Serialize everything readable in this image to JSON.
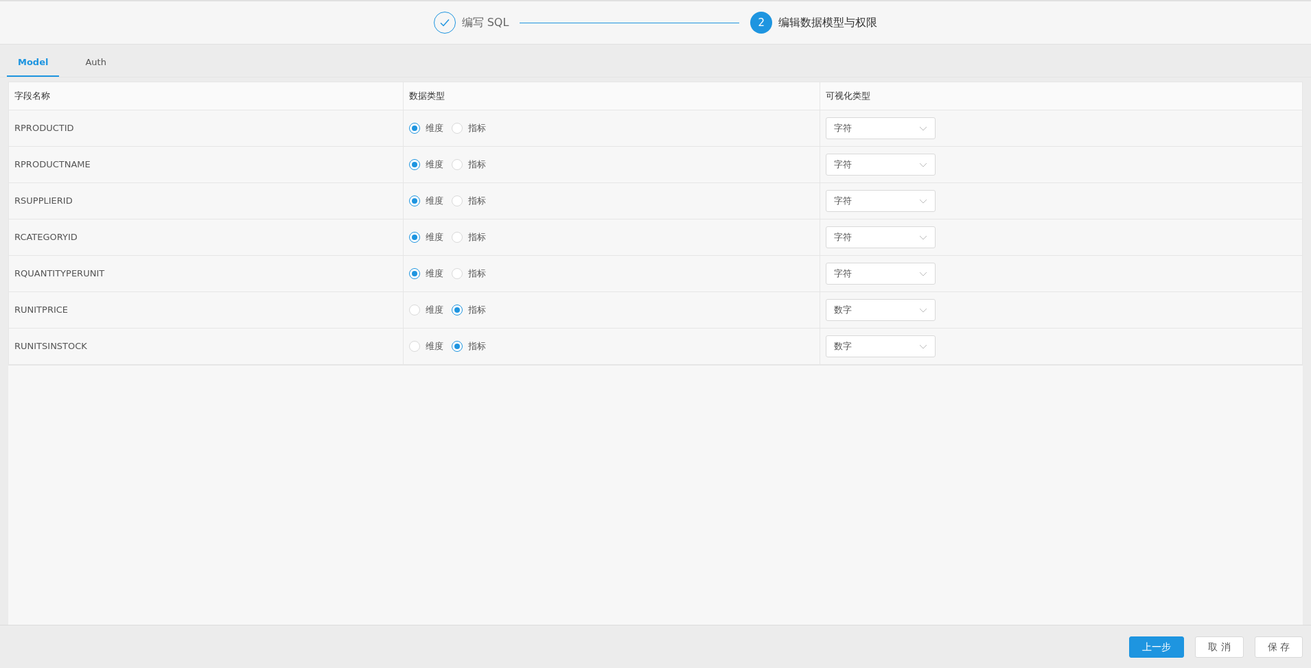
{
  "steps": [
    {
      "label": "编写 SQL",
      "completed": true
    },
    {
      "label": "编辑数据模型与权限",
      "number": "2",
      "completed": false
    }
  ],
  "tabs": [
    {
      "label": "Model",
      "selected": true
    },
    {
      "label": "Auth",
      "selected": false
    }
  ],
  "table": {
    "columns": [
      "字段名称",
      "数据类型",
      "可视化类型"
    ],
    "rows": [
      {
        "field": "RPRODUCTID",
        "options": [
          {
            "label": "维度",
            "selected": true
          },
          {
            "label": "指标",
            "selected": false
          }
        ],
        "visual_type": "字符"
      },
      {
        "field": "RPRODUCTNAME",
        "options": [
          {
            "label": "维度",
            "selected": true
          },
          {
            "label": "指标",
            "selected": false
          }
        ],
        "visual_type": "字符"
      },
      {
        "field": "RSUPPLIERID",
        "options": [
          {
            "label": "维度",
            "selected": true
          },
          {
            "label": "指标",
            "selected": false
          }
        ],
        "visual_type": "字符"
      },
      {
        "field": "RCATEGORYID",
        "options": [
          {
            "label": "维度",
            "selected": true
          },
          {
            "label": "指标",
            "selected": false
          }
        ],
        "visual_type": "字符"
      },
      {
        "field": "RQUANTITYPERUNIT",
        "options": [
          {
            "label": "维度",
            "selected": true
          },
          {
            "label": "指标",
            "selected": false
          }
        ],
        "visual_type": "字符"
      },
      {
        "field": "RUNITPRICE",
        "options": [
          {
            "label": "维度",
            "selected": false
          },
          {
            "label": "指标",
            "selected": true
          }
        ],
        "visual_type": "数字"
      },
      {
        "field": "RUNITSINSTOCK",
        "options": [
          {
            "label": "维度",
            "selected": false
          },
          {
            "label": "指标",
            "selected": true
          }
        ],
        "visual_type": "数字"
      }
    ]
  },
  "footer_buttons": [
    {
      "label": "上一步",
      "kind": "primary"
    },
    {
      "label": "取 消",
      "kind": "default"
    },
    {
      "label": "保 存",
      "kind": "default"
    }
  ]
}
